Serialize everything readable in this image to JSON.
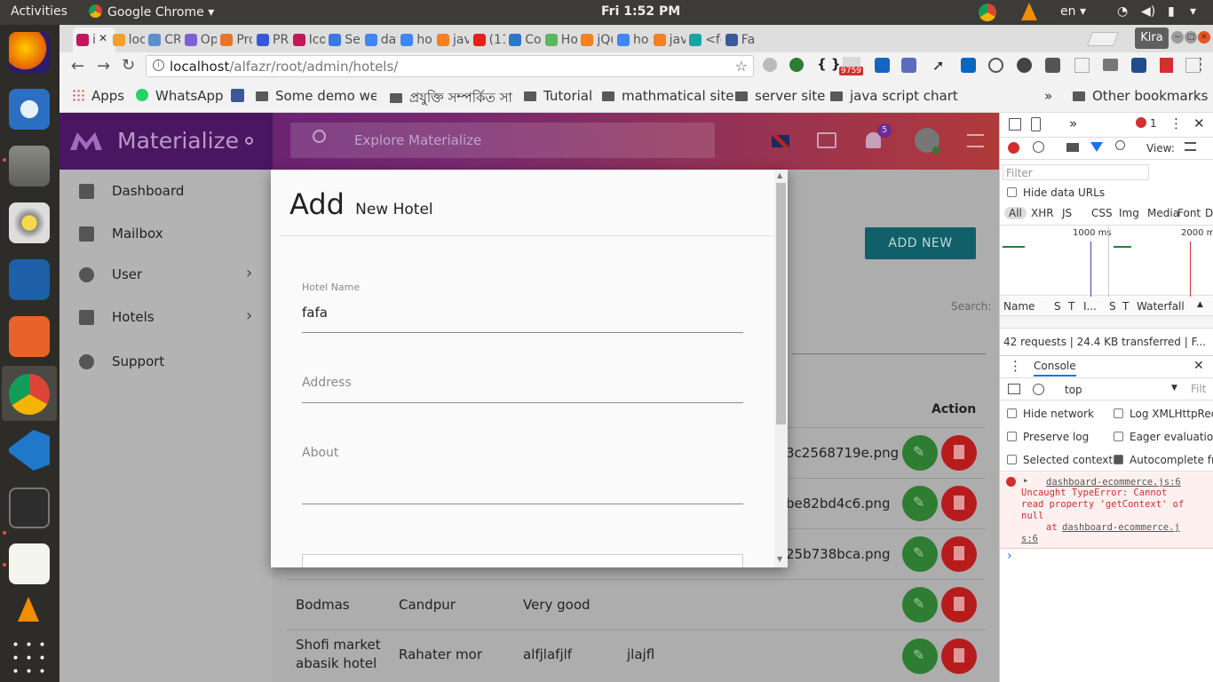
{
  "os": {
    "activities": "Activities",
    "app_name": "Google Chrome",
    "clock": "Fri  1:52 PM",
    "keyboard_layout": "en",
    "dock_apps": [
      "firefox-icon",
      "thunderbird-icon",
      "files-icon",
      "rhythmbox-icon",
      "writer-icon",
      "software-icon",
      "chrome-icon",
      "vscode-icon",
      "terminal-icon",
      "text-editor-icon",
      "vlc-icon",
      "app-grid-icon"
    ]
  },
  "browser": {
    "tabs": [
      {
        "label": "i",
        "icon": "materialize-icon",
        "color": "#c2185b"
      },
      {
        "label": "loc",
        "icon": "phpmyadmin-icon",
        "color": "#f0a030"
      },
      {
        "label": "CR",
        "icon": "avatar-icon",
        "color": "#5a8fd0"
      },
      {
        "label": "Op",
        "icon": "opera-icon",
        "color": "#7b61d8"
      },
      {
        "label": "Pro",
        "icon": "pro-icon",
        "color": "#e8762d"
      },
      {
        "label": "PR",
        "icon": "pr-icon",
        "color": "#3559d9"
      },
      {
        "label": "Ico",
        "icon": "materialize-icon",
        "color": "#c2185b"
      },
      {
        "label": "Set",
        "icon": "gear-icon",
        "color": "#3b78e7"
      },
      {
        "label": "dat",
        "icon": "google-icon",
        "color": "#4285f4"
      },
      {
        "label": "hov",
        "icon": "google-icon",
        "color": "#4285f4"
      },
      {
        "label": "jav",
        "icon": "stackoverflow-icon",
        "color": "#f48024"
      },
      {
        "label": "(11",
        "icon": "youtube-icon",
        "color": "#e62117"
      },
      {
        "label": "Co",
        "icon": "w-icon",
        "color": "#2b78c9"
      },
      {
        "label": "Ho",
        "icon": "leaf-icon",
        "color": "#5cb85c"
      },
      {
        "label": "jQu",
        "icon": "stackoverflow-icon",
        "color": "#f48024"
      },
      {
        "label": "hov",
        "icon": "google-icon",
        "color": "#4285f4"
      },
      {
        "label": "jav",
        "icon": "stackoverflow-icon",
        "color": "#f48024"
      },
      {
        "label": "<fo",
        "icon": "code-icon",
        "color": "#16a5a5"
      },
      {
        "label": "Fa",
        "icon": "facebook-icon",
        "color": "#3b5998"
      }
    ],
    "profile": "Kira",
    "url_host": "localhost",
    "url_path": "/alfazr/root/admin/hotels/",
    "ext_badge_count": "9759",
    "bookmarks": {
      "apps": "Apps",
      "whatsapp": "WhatsApp",
      "some_demo": "Some demo web",
      "bengali": "প্রযুক্তি সম্পর্কিত সাই",
      "tutorial": "Tutorial",
      "math": "mathmatical site",
      "server": "server site",
      "jschart": "java script chart",
      "overflow": "»",
      "other": "Other bookmarks"
    }
  },
  "app": {
    "brand": "Materialize",
    "search_placeholder": "Explore Materialize",
    "notification_count": "5",
    "sidebar": [
      {
        "label": "Dashboard",
        "icon": "dashboard-icon"
      },
      {
        "label": "Mailbox",
        "icon": "mail-icon"
      },
      {
        "label": "User",
        "icon": "user-icon"
      },
      {
        "label": "Hotels",
        "icon": "hotel-icon"
      },
      {
        "label": "Support",
        "icon": "help-icon"
      }
    ],
    "add_new": "ADD NEW",
    "search_label": "Search:",
    "table": {
      "action_header": "Action",
      "image_rows": [
        "3c2568719e.png",
        "be82bd4c6.png",
        "25b738bca.png"
      ],
      "rows": [
        {
          "name": "Bodmas",
          "address": "Candpur",
          "about": "Very good",
          "extra": ""
        },
        {
          "name_line1": "Shofi market",
          "name_line2": "abasik hotel",
          "address": "Rahater mor",
          "about": "alfjlafjlf",
          "extra": "jlajfl"
        }
      ]
    }
  },
  "modal": {
    "title_main": "Add",
    "title_sub": "New Hotel",
    "fields": {
      "hotel_name_label": "Hotel Name",
      "hotel_name_value": "fafa",
      "address_label": "Address",
      "about_label": "About"
    }
  },
  "devtools": {
    "error_count": "1",
    "view_label": "View:",
    "filter_placeholder": "Filter",
    "hide_data_urls": "Hide data URLs",
    "type_filters": [
      "All",
      "XHR",
      "JS",
      "CSS",
      "Img",
      "Media",
      "Font",
      "D"
    ],
    "timeline_1": "1000 ms",
    "timeline_2": "2000 m",
    "columns": [
      "Name",
      "S",
      "T",
      "I...",
      "S",
      "T",
      "Waterfall"
    ],
    "summary": "42 requests  |  24.4 KB transferred  |  F...",
    "console_tab": "Console",
    "context": "top",
    "filt": "Filt",
    "options": {
      "hide_network": "Hide network",
      "log_xhr": "Log XMLHttpReq",
      "preserve_log": "Preserve log",
      "eager": "Eager evaluation",
      "selected_context": "Selected context",
      "autocomplete": "Autocomplete fro"
    },
    "error": {
      "source": "dashboard-ecommerce.js:6",
      "line1": "Uncaught TypeError: Cannot",
      "line2": "read property 'getContext' of",
      "line3": "null",
      "at_prefix": "at ",
      "at_link1": "dashboard-ecommerce.j",
      "at_link2": "s:6"
    },
    "prompt": "›"
  }
}
